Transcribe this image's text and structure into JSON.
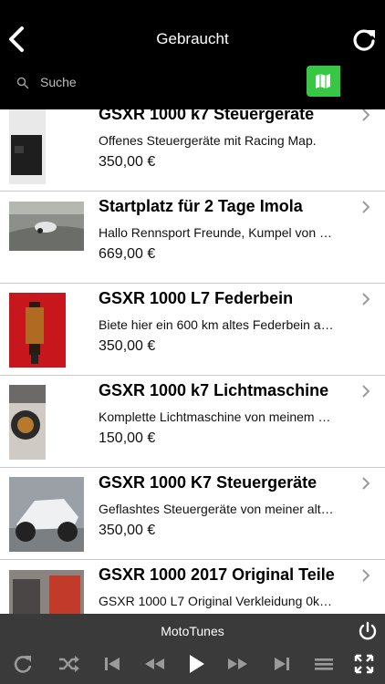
{
  "header": {
    "title": "Gebraucht",
    "search_placeholder": "Suche",
    "colors": {
      "active_toggle": "#38c744",
      "inactive_toggle": "#2e7f2f"
    }
  },
  "items": [
    {
      "title": "GSXR 1000 k7 Steuergeräte",
      "desc": "Offenes Steuergeräte mit Racing Map.",
      "price": "350,00 €"
    },
    {
      "title": "Startplatz für 2 Tage Imola",
      "desc": "Hallo Rennsport Freunde, Kumpel von …",
      "price": "669,00 €"
    },
    {
      "title": "GSXR 1000 L7 Federbein",
      "desc": "Biete hier ein 600 km altes Federbein a…",
      "price": "350,00 €"
    },
    {
      "title": "GSXR 1000 k7 Lichtmaschine",
      "desc": "Komplette Lichtmaschine von meinem …",
      "price": "150,00 €"
    },
    {
      "title": "GSXR 1000 K7 Steuergeräte",
      "desc": "Geflashtes Steuergeräte von meiner alt…",
      "price": "350,00 €"
    },
    {
      "title": "GSXR 1000 2017 Original Teile",
      "desc": "GSXR 1000 L7 Original Verkleidung 0k…",
      "price": ""
    }
  ],
  "player": {
    "title": "MotoTunes",
    "controls": [
      "repeat-icon",
      "shuffle-icon",
      "skip-back-icon",
      "rewind-icon",
      "play-icon",
      "fast-forward-icon",
      "skip-forward-icon",
      "menu-icon",
      "fullscreen-icon"
    ]
  }
}
